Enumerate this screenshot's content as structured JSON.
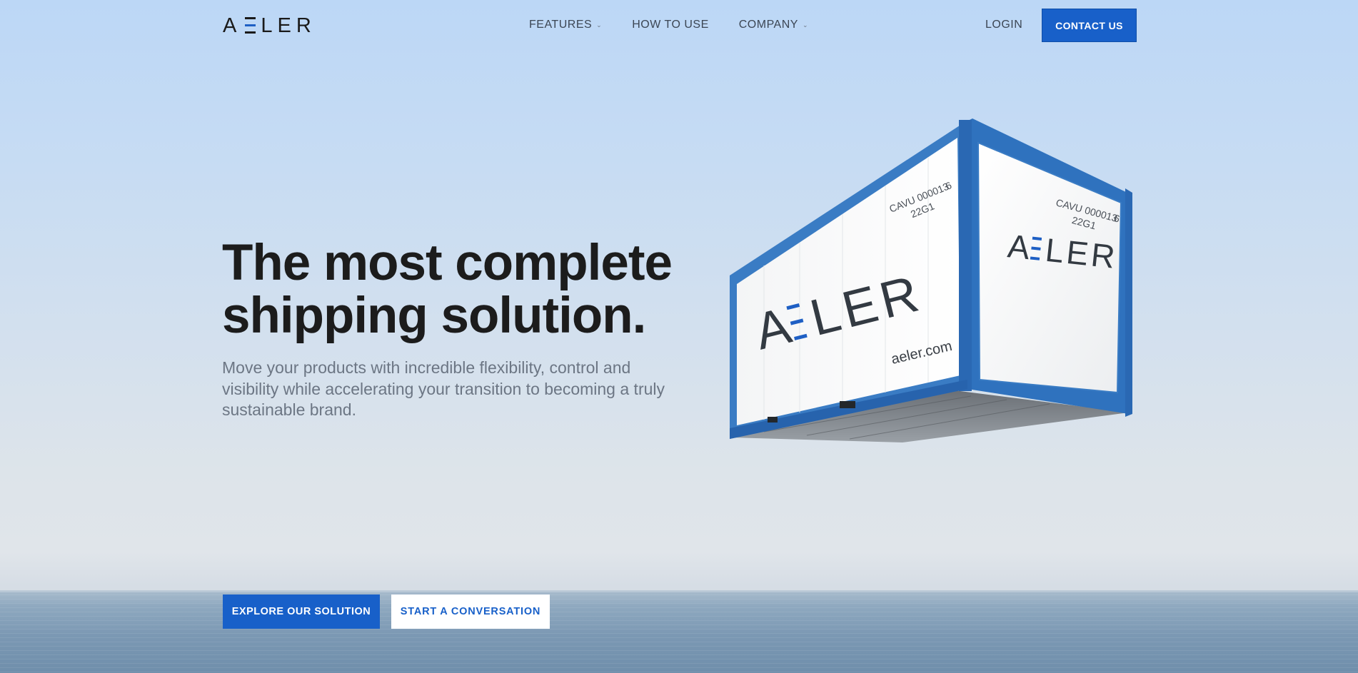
{
  "header": {
    "logo_text": "AELER",
    "nav": [
      {
        "label": "FEATURES",
        "has_dropdown": true
      },
      {
        "label": "HOW TO USE",
        "has_dropdown": false
      },
      {
        "label": "COMPANY",
        "has_dropdown": true
      }
    ],
    "login_label": "LOGIN",
    "contact_label": "CONTACT US"
  },
  "hero": {
    "title_line1": "The most complete",
    "title_line2": "shipping solution.",
    "subtitle": "Move your products with incredible flexibility, control and visibility while accelerating your transition to becoming a truly sustainable brand.",
    "primary_cta": "EXPLORE OUR SOLUTION",
    "secondary_cta": "START A CONVERSATION"
  },
  "container": {
    "side_logo": "AELER",
    "end_logo": "AELER",
    "website": "aeler.com",
    "code_line1": "CAVU 000013",
    "code_check": "6",
    "code_line2": "22G1"
  },
  "colors": {
    "brand_blue": "#1860c9",
    "container_blue": "#3a7cc4",
    "text_dark": "#1c1c1c",
    "text_muted": "#6c7684"
  },
  "icons": {
    "dropdown": "chevron-down-icon"
  }
}
